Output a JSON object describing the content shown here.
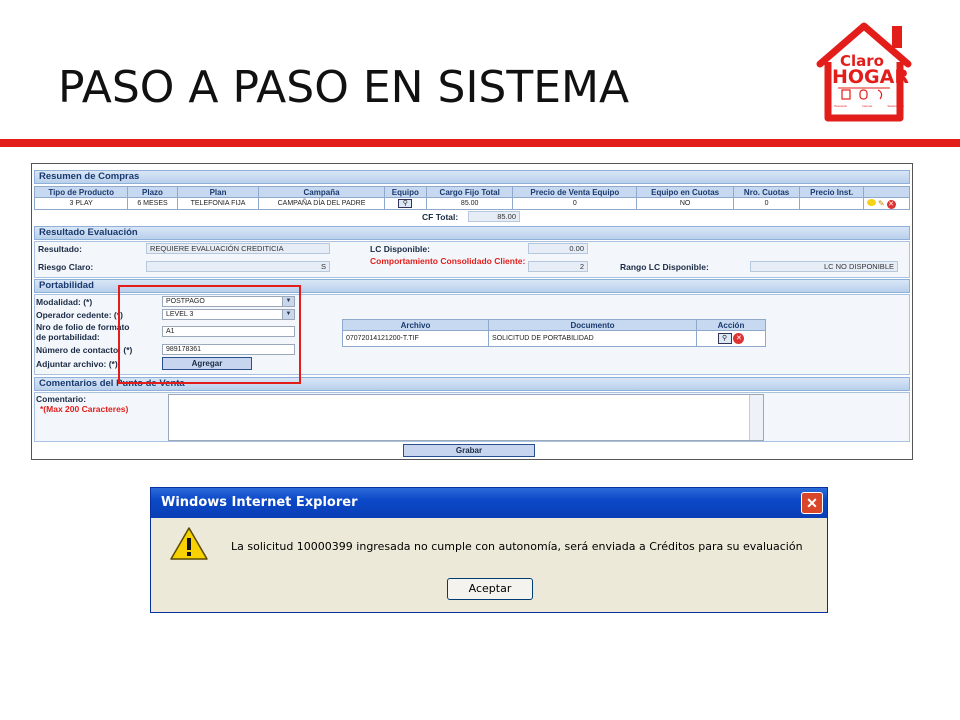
{
  "slide": {
    "title": "PASO A PASO EN SISTEMA"
  },
  "logo": {
    "line1": "Claro",
    "line2": "HOGAR",
    "captions": [
      "Televisión",
      "Internet",
      "Telefonía fija"
    ]
  },
  "colors": {
    "brand_red": "#e31d1a",
    "header_blue": "#1a3a6e",
    "dialog_blue": "#0b48c8"
  },
  "resumen": {
    "title": "Resumen de Compras",
    "headers": [
      "Tipo de Producto",
      "Plazo",
      "Plan",
      "Campaña",
      "Equipo",
      "Cargo Fijo Total",
      "Precio de Venta Equipo",
      "Equipo en Cuotas",
      "Nro. Cuotas",
      "Precio Inst."
    ],
    "row": [
      "3 PLAY",
      "6 MESES",
      "TELEFONIA FIJA",
      "CAMPAÑA DÍA DEL PADRE",
      "",
      "85.00",
      "0",
      "NO",
      "0",
      ""
    ],
    "cf_total_label": "CF Total:",
    "cf_total_value": "85.00"
  },
  "evaluacion": {
    "title": "Resultado Evaluación",
    "resultado_label": "Resultado:",
    "resultado_value": "REQUIERE EVALUACIÓN CREDITICIA",
    "riesgo_label": "Riesgo Claro:",
    "riesgo_value": "S",
    "lc_label": "LC Disponible:",
    "lc_value": "0.00",
    "comportamiento_label": "Comportamiento Consolidado Cliente:",
    "comportamiento_value": "2",
    "rango_label": "Rango LC Disponible:",
    "rango_value": "LC NO DISPONIBLE"
  },
  "portabilidad": {
    "title": "Portabilidad",
    "modalidad_label": "Modalidad: (*)",
    "modalidad_value": "POSTPAGO",
    "operador_label": "Operador cedente: (*)",
    "operador_value": "LEVEL 3",
    "folio_label1": "Nro de folio de formato",
    "folio_label2": "de portabilidad:",
    "folio_value": "A1",
    "contacto_label": "Número de contacto: (*)",
    "contacto_value": "989178361",
    "adjuntar_label": "Adjuntar archivo: (*)",
    "agregar_button": "Agregar",
    "files_headers": [
      "Archivo",
      "Documento",
      "Acción"
    ],
    "file_row": [
      "07072014121200-T.TIF",
      "SOLICITUD DE PORTABILIDAD"
    ]
  },
  "comentarios": {
    "title": "Comentarios del Punto de Venta",
    "comentario_label": "Comentario:",
    "max_label": "*(Max 200 Caracteres)",
    "grabar_button": "Grabar"
  },
  "dialog": {
    "title": "Windows Internet Explorer",
    "message": "La solicitud 10000399 ingresada no cumple con autonomía, será enviada a Créditos para su evaluación",
    "ok_button": "Aceptar",
    "icon": "warning-icon"
  }
}
